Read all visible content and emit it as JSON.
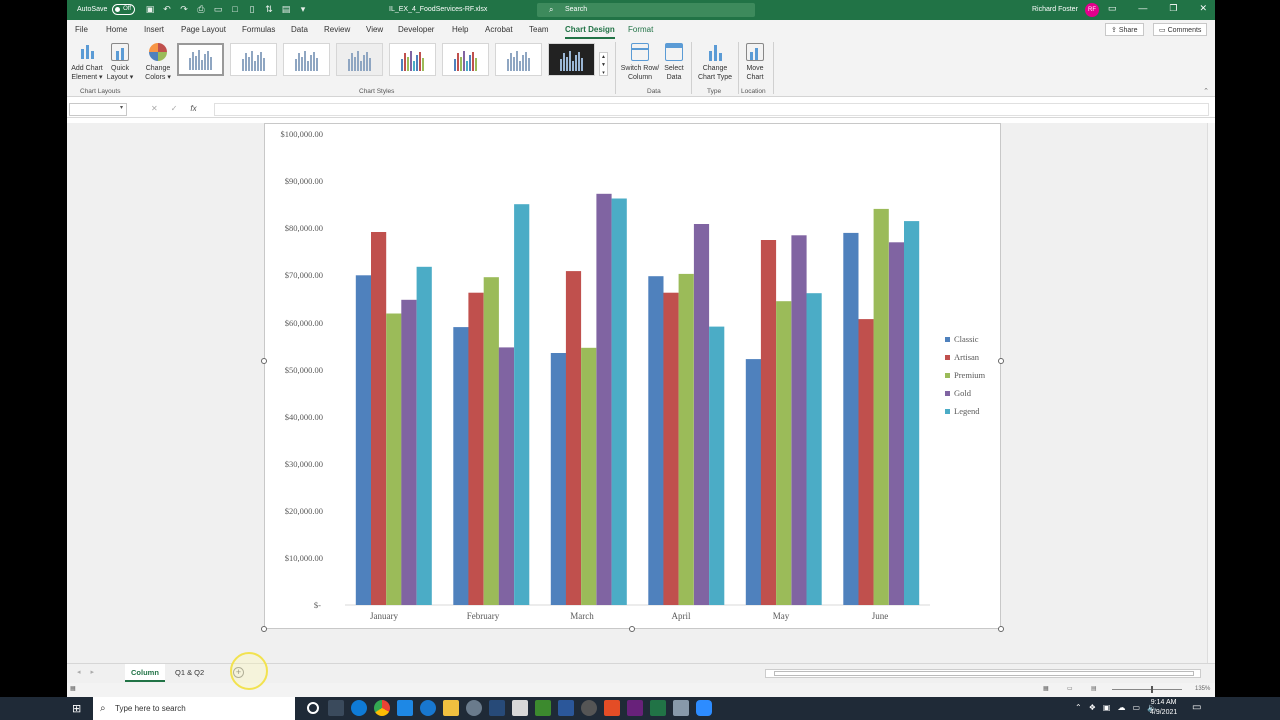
{
  "titlebar": {
    "autosave_label": "AutoSave",
    "autosave_state": "Off",
    "doc_title": "IL_EX_4_FoodServices-RF.xlsx",
    "search_placeholder": "Search",
    "user_name": "Richard Foster",
    "user_initials": "RF"
  },
  "tabs": [
    "File",
    "Home",
    "Insert",
    "Page Layout",
    "Formulas",
    "Data",
    "Review",
    "View",
    "Developer",
    "Help",
    "Acrobat",
    "Team",
    "Chart Design",
    "Format"
  ],
  "active_tab": "Chart Design",
  "share_label": "Share",
  "comments_label": "Comments",
  "ribbon": {
    "add_chart_element": "Add Chart Element",
    "quick_layout": "Quick Layout",
    "change_colors": "Change Colors",
    "chart_layouts_group": "Chart Layouts",
    "chart_styles_group": "Chart Styles",
    "switch_row_column": "Switch Row/ Column",
    "select_data": "Select Data",
    "data_group": "Data",
    "change_chart_type": "Change Chart Type",
    "type_group": "Type",
    "move_chart": "Move Chart",
    "location_group": "Location"
  },
  "formula_bar": {
    "fx_label": "fx"
  },
  "chart_data": {
    "type": "bar",
    "categories": [
      "January",
      "February",
      "March",
      "April",
      "May",
      "June"
    ],
    "series": [
      {
        "name": "Classic",
        "color": "#4f81bd",
        "values": [
          70000,
          59000,
          53500,
          69800,
          52200,
          79000
        ]
      },
      {
        "name": "Artisan",
        "color": "#c0504d",
        "values": [
          79200,
          66300,
          70900,
          66300,
          77500,
          60700
        ]
      },
      {
        "name": "Premium",
        "color": "#9bbb59",
        "values": [
          61900,
          69600,
          54600,
          70300,
          64500,
          84100
        ]
      },
      {
        "name": "Gold",
        "color": "#8064a2",
        "values": [
          64800,
          54700,
          87300,
          80900,
          78500,
          77000
        ]
      },
      {
        "name": "Legend",
        "color": "#4bacc6",
        "values": [
          71800,
          85100,
          86300,
          59100,
          66200,
          81500
        ]
      }
    ],
    "ylim": [
      0,
      100000
    ],
    "yticks": [
      "$-",
      "$10,000.00",
      "$20,000.00",
      "$30,000.00",
      "$40,000.00",
      "$50,000.00",
      "$60,000.00",
      "$70,000.00",
      "$80,000.00",
      "$90,000.00",
      "$100,000.00"
    ],
    "legend_position": "right",
    "grid": false
  },
  "sheet_tabs": [
    "Column",
    "Q1 & Q2"
  ],
  "active_sheet": "Column",
  "statusbar": {
    "zoom": "135%"
  },
  "taskbar": {
    "search_placeholder": "Type here to search",
    "time": "9:14 AM",
    "date": "4/9/2021"
  }
}
